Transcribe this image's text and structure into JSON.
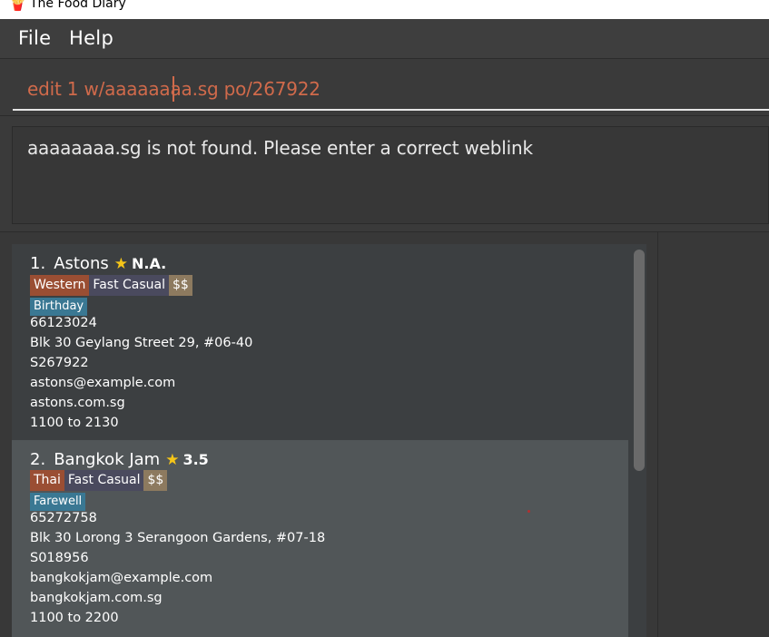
{
  "window": {
    "title": "The Food Diary",
    "icon": "fries-icon"
  },
  "menu": {
    "items": [
      "File",
      "Help"
    ]
  },
  "command": {
    "value": "edit 1 w/aaaaaaaa.sg po/267922"
  },
  "result": {
    "message": "aaaaaaaa.sg is not found. Please enter a correct weblink"
  },
  "entries": [
    {
      "index": "1.",
      "name": "Astons",
      "rating": "N.A.",
      "tags": [
        "Western",
        "Fast Casual",
        "$$"
      ],
      "occasion": "Birthday",
      "phone": "66123024",
      "address": "Blk 30 Geylang Street 29, #06-40",
      "postal": "S267922",
      "email": "astons@example.com",
      "website": "astons.com.sg",
      "hours": "1100 to 2130"
    },
    {
      "index": "2.",
      "name": "Bangkok Jam",
      "rating": "3.5",
      "tags": [
        "Thai",
        "Fast Casual",
        "$$"
      ],
      "occasion": "Farewell",
      "phone": "65272758",
      "address": "Blk 30 Lorong 3 Serangoon Gardens, #07-18",
      "postal": "S018956",
      "email": "bangkokjam@example.com",
      "website": "bangkokjam.com.sg",
      "hours": "1100 to 2200"
    }
  ],
  "colors": {
    "cuisine_tag": "#9a4e33",
    "style_tag": "#4a4a5e",
    "price_tag": "#8d7a5f",
    "occasion_tag": "#3a7893",
    "command_text": "#d06a4b",
    "star": "#f5c518"
  }
}
